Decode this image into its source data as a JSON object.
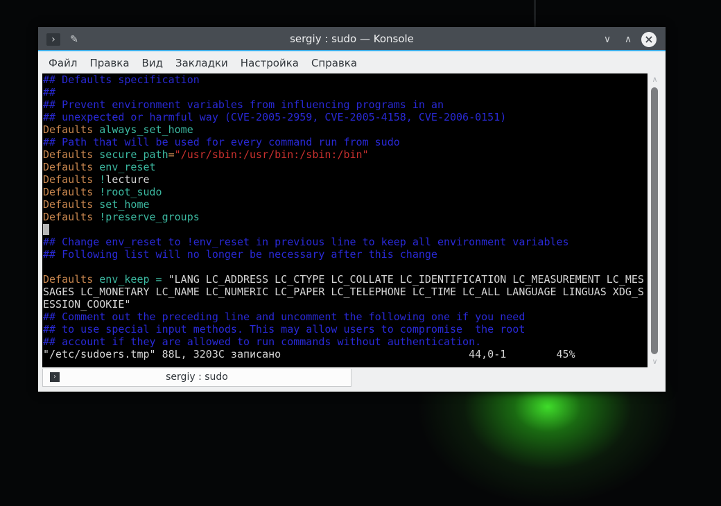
{
  "window": {
    "title": "sergiy : sudo — Konsole",
    "minimize_icon": "chevron-down-icon",
    "maximize_icon": "chevron-up-icon",
    "close_icon": "close-icon"
  },
  "menu": [
    "Файл",
    "Правка",
    "Вид",
    "Закладки",
    "Настройка",
    "Справка"
  ],
  "colors": {
    "comment": "#2929d6",
    "keyword": "#c8864e",
    "option": "#3cb9a1",
    "string": "#c8302e",
    "text": "#d4d4d4"
  },
  "terminal": {
    "lines": [
      [
        [
          "## Defaults specification",
          "c"
        ]
      ],
      [
        [
          "##",
          "c"
        ]
      ],
      [
        [
          "## Prevent environment variables from influencing programs in an",
          "c"
        ]
      ],
      [
        [
          "## unexpected or harmful way (CVE-2005-2959, CVE-2005-4158, CVE-2006-0151)",
          "c"
        ]
      ],
      [
        [
          "Defaults ",
          "d"
        ],
        [
          "always_set_home",
          "k"
        ]
      ],
      [
        [
          "## Path that will be used for every command run from sudo",
          "c"
        ]
      ],
      [
        [
          "Defaults ",
          "d"
        ],
        [
          "secure_path",
          "k"
        ],
        [
          "=",
          "d"
        ],
        [
          "\"/usr/sbin:/usr/bin:/sbin:/bin\"",
          "s"
        ]
      ],
      [
        [
          "Defaults ",
          "d"
        ],
        [
          "env_reset",
          "k"
        ]
      ],
      [
        [
          "Defaults ",
          "d"
        ],
        [
          "!",
          "k"
        ],
        [
          "lecture",
          "p"
        ]
      ],
      [
        [
          "Defaults ",
          "d"
        ],
        [
          "!root_sudo",
          "k"
        ]
      ],
      [
        [
          "Defaults ",
          "d"
        ],
        [
          "set_home",
          "k"
        ]
      ],
      [
        [
          "Defaults ",
          "d"
        ],
        [
          "!preserve_groups",
          "k"
        ]
      ],
      [],
      [
        [
          "## Change env_reset to !env_reset in previous line to keep all environment variables",
          "c"
        ]
      ],
      [
        [
          "## Following list will no longer be necessary after this change",
          "c"
        ]
      ],
      [],
      [
        [
          "Defaults ",
          "d"
        ],
        [
          "env_keep",
          "k"
        ],
        [
          " = ",
          "k"
        ],
        [
          "\"LANG LC_ADDRESS LC_CTYPE LC_COLLATE LC_IDENTIFICATION LC_MEASUREMENT LC_MES",
          "p"
        ]
      ],
      [
        [
          "SAGES LC_MONETARY LC_NAME LC_NUMERIC LC_PAPER LC_TELEPHONE LC_TIME LC_ALL LANGUAGE LINGUAS XDG_S",
          "p"
        ]
      ],
      [
        [
          "ESSION_COOKIE\"",
          "p"
        ]
      ],
      [
        [
          "## Comment out the preceding line and uncomment the following one if you need",
          "c"
        ]
      ],
      [
        [
          "## to use special input methods. This may allow users to compromise  the root",
          "c"
        ]
      ],
      [
        [
          "## account if they are allowed to run commands without authentication.",
          "c"
        ]
      ],
      [
        [
          "\"/etc/sudoers.tmp\" 88L, 3203C записано                              44,0-1        45%",
          "p"
        ]
      ]
    ],
    "cursor_line": 12,
    "scroll_position_percent": 45
  },
  "tab": {
    "label": "sergiy : sudo"
  }
}
